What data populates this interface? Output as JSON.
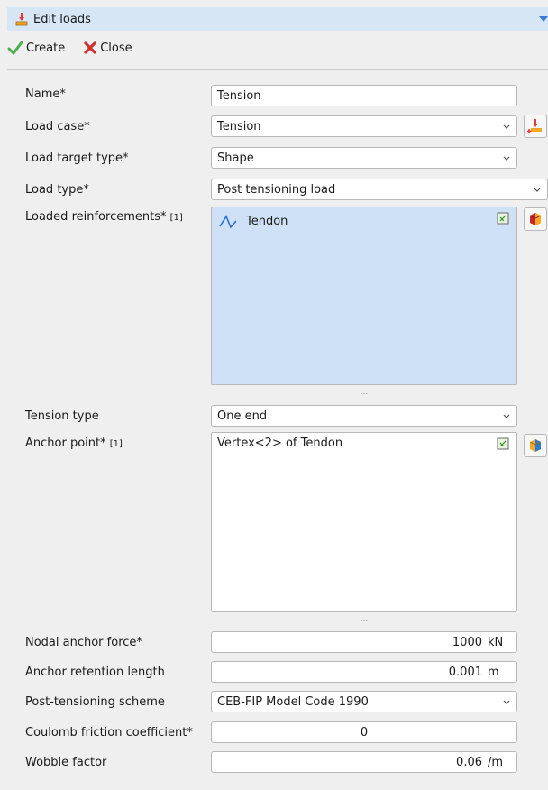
{
  "window": {
    "title": "Edit loads"
  },
  "toolbar": {
    "create_label": "Create",
    "close_label": "Close"
  },
  "form": {
    "name": {
      "label": "Name*",
      "value": "Tension"
    },
    "load_case": {
      "label": "Load case*",
      "value": "Tension"
    },
    "load_target_type": {
      "label": "Load target type*",
      "value": "Shape"
    },
    "load_type": {
      "label": "Load type*",
      "value": "Post tensioning load"
    },
    "loaded_reinforcements": {
      "label": "Loaded reinforcements*",
      "count": "[1]",
      "items": [
        "Tendon"
      ]
    },
    "tension_type": {
      "label": "Tension type",
      "value": "One end"
    },
    "anchor_point": {
      "label": "Anchor point*",
      "count": "[1]",
      "items": [
        "Vertex<2> of Tendon"
      ]
    },
    "nodal_anchor_force": {
      "label": "Nodal anchor force*",
      "value": "1000",
      "unit": "kN"
    },
    "anchor_retention_length": {
      "label": "Anchor retention length",
      "value": "0.001",
      "unit": "m"
    },
    "post_tensioning_scheme": {
      "label": "Post-tensioning scheme",
      "value": "CEB-FIP Model Code 1990"
    },
    "coulomb_friction": {
      "label": "Coulomb friction coefficient*",
      "value": "0"
    },
    "wobble_factor": {
      "label": "Wobble factor",
      "value": "0.06",
      "unit": "/m"
    }
  },
  "grip_glyph": "...",
  "colors": {
    "title_bar": "#d6e6f5",
    "selection": "#cfe1f6",
    "accent_blue": "#3a7bd5",
    "create_green": "#4caf50",
    "close_red": "#d32f2f"
  },
  "icons": [
    "load-icon",
    "collapse-arrow-icon",
    "check-icon",
    "x-icon",
    "chevron-down-icon",
    "tendon-icon",
    "clear-selection-icon",
    "load-case-add-icon",
    "select-shape-icon"
  ]
}
